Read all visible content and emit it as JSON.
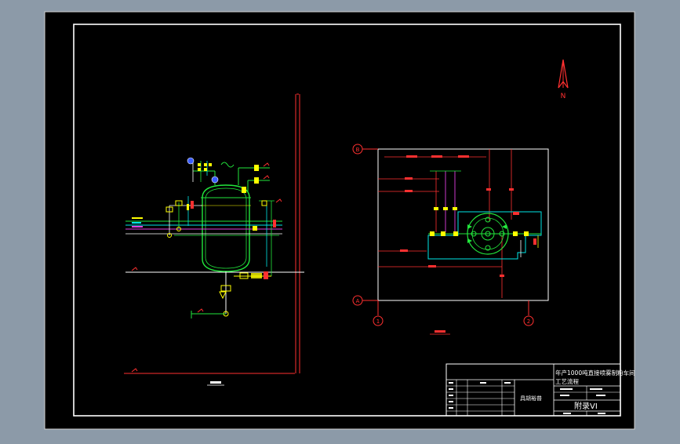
{
  "colors": {
    "background": "#8c9aa8",
    "sheet": "#000000",
    "frame": "#ffffff",
    "red": "#ff2a2a",
    "green": "#22e63c",
    "yellow": "#ffff00",
    "cyan": "#00e6e6",
    "magenta": "#e040e0",
    "blue": "#3a5cff",
    "white": "#ffffff"
  },
  "icons": {
    "north_arrow": "north-arrow-icon",
    "gridline_bubble": "gridline-bubble-icon"
  },
  "plan_view": {
    "grid_labels": {
      "top_left": "B",
      "bottom_left": "A",
      "bottom_1": "1",
      "bottom_2": "2"
    },
    "north_label": "N"
  },
  "title_block": {
    "title_line1": "年产1000吨直接喷雾制粉车间",
    "title_line2": "工艺流程",
    "drawing_label": "附录VI",
    "stamp": "具胡裕普"
  }
}
